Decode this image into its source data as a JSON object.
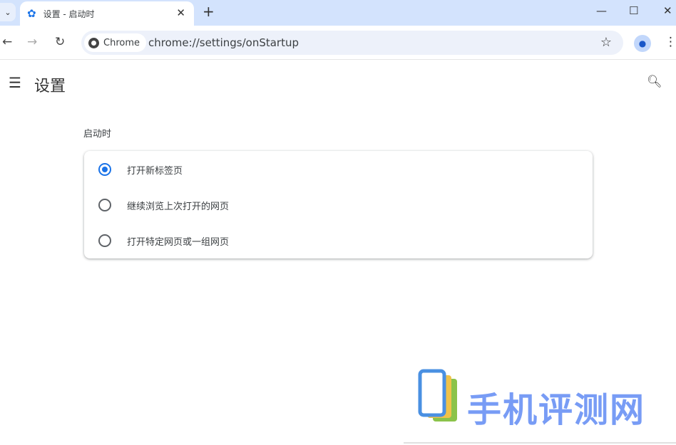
{
  "browser": {
    "tab_title": "设置 - 启动时",
    "new_tab": "+",
    "chip_label": "Chrome",
    "url": "chrome://settings/onStartup"
  },
  "header": {
    "title": "设置"
  },
  "startup": {
    "section_title": "启动时",
    "options": [
      {
        "label": "打开新标签页",
        "selected": true
      },
      {
        "label": "继续浏览上次打开的网页",
        "selected": false
      },
      {
        "label": "打开特定网页或一组网页",
        "selected": false
      }
    ]
  },
  "watermark": {
    "text": "手机评测网"
  },
  "colors": {
    "accent": "#1a73e8",
    "tabbar": "#d3e3fd",
    "watermark": "#789cf5"
  }
}
